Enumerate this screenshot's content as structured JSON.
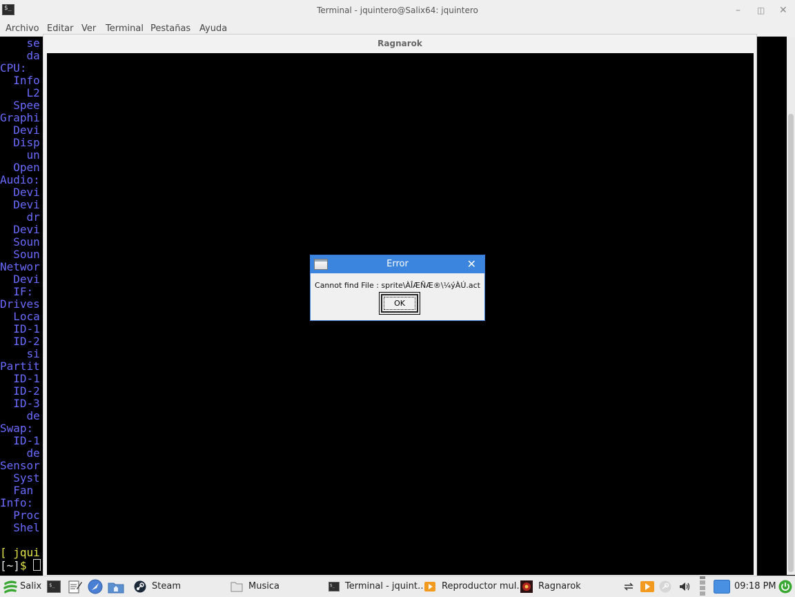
{
  "terminal": {
    "title": "Terminal - jquintero@Salix64: jquintero",
    "icon_text": "$_",
    "controls": {
      "minimize": "–",
      "maximize": "◫",
      "close": "✕"
    },
    "menu": [
      "Archivo",
      "Editar",
      "Ver",
      "Terminal",
      "Pestañas",
      "Ayuda"
    ],
    "lines": [
      {
        "text": "    se"
      },
      {
        "text": "    da"
      },
      {
        "text": "CPU:"
      },
      {
        "text": "  Info"
      },
      {
        "text": "    L2"
      },
      {
        "text": "  Spee"
      },
      {
        "text": "Graphi"
      },
      {
        "text": "  Devi"
      },
      {
        "text": "  Disp"
      },
      {
        "text": "    un"
      },
      {
        "text": "  Open"
      },
      {
        "text": "Audio:"
      },
      {
        "text": "  Devi"
      },
      {
        "text": "  Devi"
      },
      {
        "text": "    dr"
      },
      {
        "text": "  Devi"
      },
      {
        "text": "  Soun"
      },
      {
        "text": "  Soun"
      },
      {
        "text": "Networ"
      },
      {
        "text": "  Devi"
      },
      {
        "text": "  IF:"
      },
      {
        "text": "Drives"
      },
      {
        "text": "  Loca"
      },
      {
        "text": "  ID-1"
      },
      {
        "text": "  ID-2"
      },
      {
        "text": "    si"
      },
      {
        "text": "Partit"
      },
      {
        "text": "  ID-1"
      },
      {
        "text": "  ID-2"
      },
      {
        "text": "  ID-3"
      },
      {
        "text": "    de"
      },
      {
        "text": "Swap:"
      },
      {
        "text": "  ID-1"
      },
      {
        "text": "    de"
      },
      {
        "text": "Sensor"
      },
      {
        "text": "  Syst"
      },
      {
        "text": "  Fan"
      },
      {
        "text": "Info:"
      },
      {
        "text": "  Proc"
      },
      {
        "text": "  Shel"
      }
    ],
    "prompt_line1": "[ jqui",
    "prompt_line2_bracket": "[~]",
    "prompt_line2_dollar": "$"
  },
  "ragnarok_window": {
    "title": "Ragnarok"
  },
  "error_dialog": {
    "title": "Error",
    "close": "✕",
    "message": "Cannot find File : sprite\\ÀÎÆÑÆ®\\¼ýÀÚ.act",
    "ok_label": "OK"
  },
  "taskbar": {
    "start_label": "Salix",
    "launchers": [
      "terminal-icon",
      "text-editor-icon",
      "browser-icon",
      "file-manager-icon"
    ],
    "items": [
      {
        "label": "Steam",
        "icon": "steam-icon"
      },
      {
        "label": "Musica",
        "icon": "folder-icon"
      },
      {
        "label": "Terminal - jquint…",
        "icon": "terminal-icon"
      },
      {
        "label": "Reproductor mul…",
        "icon": "media-player-icon"
      },
      {
        "label": "Ragnarok",
        "icon": "ragnarok-icon"
      }
    ],
    "clock": "09:18 PM",
    "colors": {
      "accent": "#3c85de",
      "start_green": "#3aa832"
    }
  }
}
